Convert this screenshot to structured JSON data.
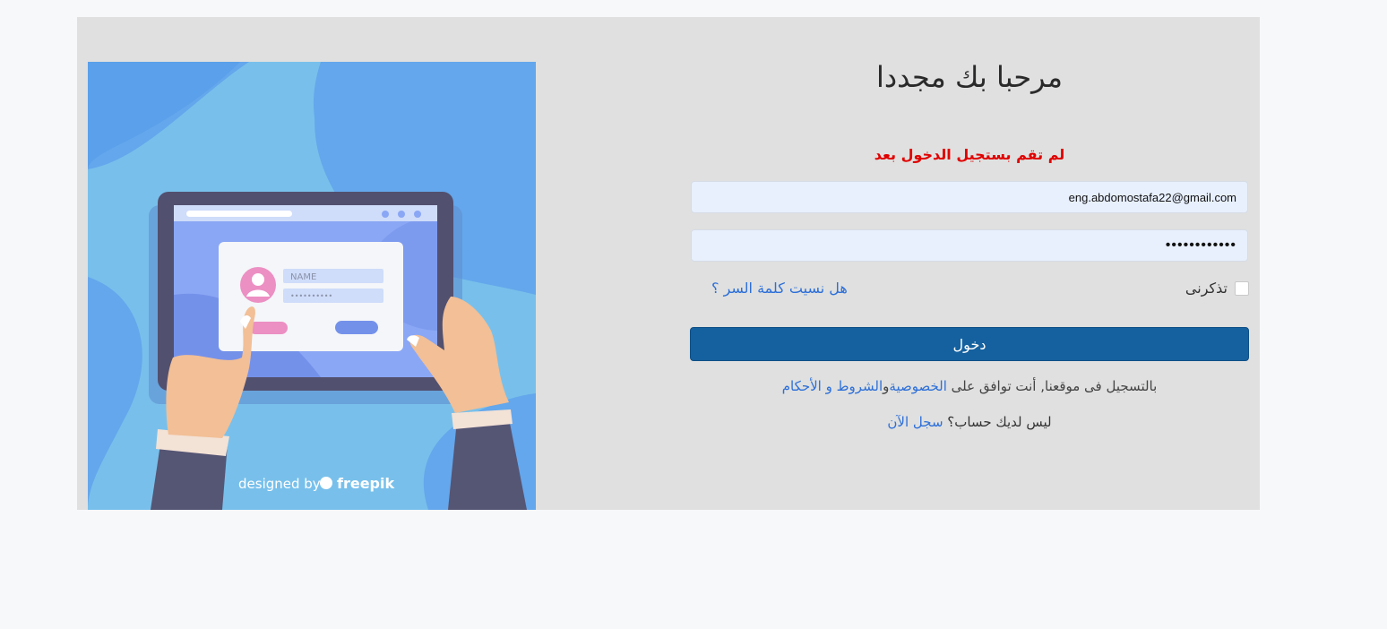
{
  "form": {
    "title": "مرحبا بك مجددا",
    "error_message": "لم تقم بستجيل الدخول بعد",
    "email_value": "eng.abdomostafa22@gmail.com",
    "password_value": "••••••••••••",
    "remember_label": "تذكرنى",
    "forgot_link": "هل نسيت كلمة السر ؟",
    "login_button": "دخول",
    "terms_text": "بالتسجيل فى موقعنا, أنت توافق على ",
    "privacy_link": "الخصوصية",
    "terms_conjunction": "و",
    "terms_link": "الشروط و الأحكام",
    "signup_text": "ليس لديك حساب؟ ",
    "signup_link": "سجل الآن"
  },
  "illustration": {
    "name_placeholder": "NAME",
    "password_placeholder": "••••••••••",
    "credit_text": "designed by",
    "credit_brand": "freepik"
  },
  "colors": {
    "accent": "#15619f",
    "link": "#2d6fd9",
    "error": "#e00000",
    "card_bg": "#dfe0df",
    "input_bg": "#e8f0fe"
  }
}
